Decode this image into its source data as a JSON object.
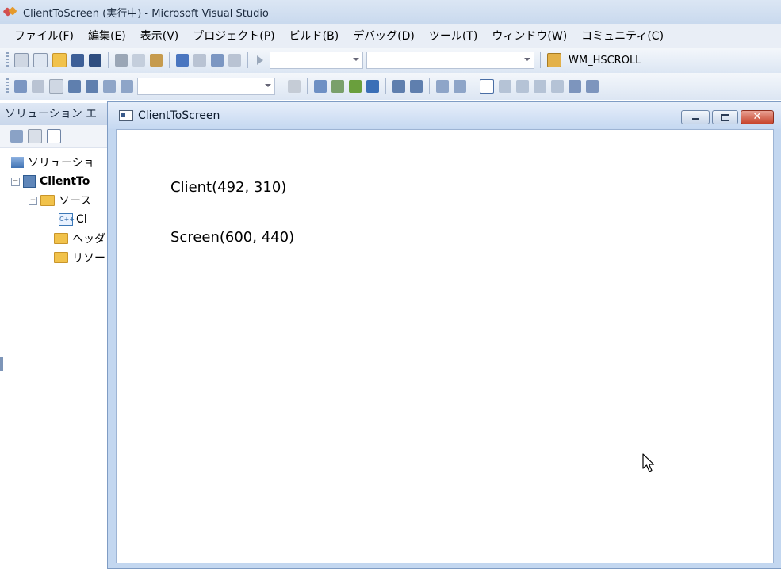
{
  "vs": {
    "title": "ClientToScreen (実行中) - Microsoft Visual Studio",
    "menu": [
      "ファイル(F)",
      "編集(E)",
      "表示(V)",
      "プロジェクト(P)",
      "ビルド(B)",
      "デバッグ(D)",
      "ツール(T)",
      "ウィンドウ(W)",
      "コミュニティ(C)"
    ],
    "toolbar": {
      "find_combo_value": "WM_HSCROLL"
    }
  },
  "solution_explorer": {
    "header": "ソリューション エ",
    "tree": [
      {
        "label": "ソリューショ",
        "icon": "solution-icon"
      },
      {
        "label": "ClientTo",
        "icon": "project-icon"
      },
      {
        "label": "ソース",
        "icon": "folder-icon"
      },
      {
        "label": "Cl",
        "icon": "cpp-file-icon"
      },
      {
        "label": "ヘッダ",
        "icon": "folder-icon"
      },
      {
        "label": "リソー",
        "icon": "folder-icon"
      }
    ]
  },
  "app_window": {
    "title": "ClientToScreen",
    "close_glyph": "✕",
    "client_line": "Client(492, 310)",
    "screen_line": "Screen(600, 440)"
  },
  "colors": {
    "title_gradient_top": "#dbe6f4",
    "window_frame": "#c3d7f0",
    "close_button": "#c7432b"
  }
}
